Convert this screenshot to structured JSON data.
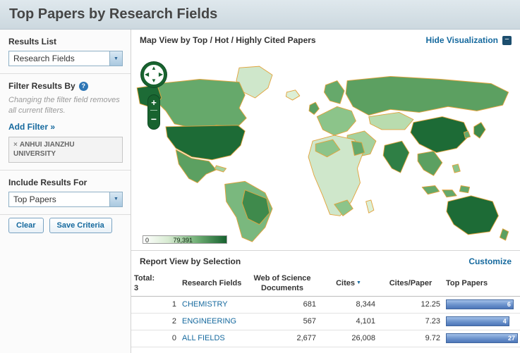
{
  "page": {
    "title": "Top Papers by Research Fields"
  },
  "icons": {
    "help": "?",
    "minus": "−",
    "select_arrow": "▼",
    "sort_desc": "▼",
    "pan_up": "▲",
    "pan_down": "▼",
    "pan_left": "◀",
    "pan_right": "▶",
    "zoom_in": "+",
    "zoom_out": "−"
  },
  "sidebar": {
    "results_list_label": "Results List",
    "results_list_value": "Research Fields",
    "filter_by_label": "Filter Results By",
    "filter_note": "Changing the filter field removes all current filters.",
    "add_filter_link": "Add Filter »",
    "filters": [
      {
        "remove": "×",
        "label": "ANHUI JIANZHU UNIVERSITY"
      }
    ],
    "include_label": "Include Results For",
    "include_value": "Top Papers",
    "clear_button": "Clear",
    "save_button": "Save Criteria"
  },
  "map": {
    "title": "Map View by Top / Hot / Highly Cited Papers",
    "hide_link": "Hide Visualization",
    "scale_min": "0",
    "scale_max": "79,391",
    "colors": {
      "lowest": "#f2f8ee",
      "highest": "#1d6b36",
      "country_border": "#e2a33c"
    }
  },
  "report": {
    "title": "Report View by Selection",
    "customize_link": "Customize",
    "total_label": "Total:",
    "total_value": "3",
    "columns": {
      "fields": "Research Fields",
      "docs_line1": "Web of Science",
      "docs_line2": "Documents",
      "cites": "Cites",
      "cites_per_paper": "Cites/Paper",
      "top_papers": "Top Papers"
    },
    "rows": [
      {
        "rank": "1",
        "field": "CHEMISTRY",
        "docs": "681",
        "cites": "8,344",
        "cites_per_paper": "12.25",
        "top_papers": "6",
        "bar_pct": "94%"
      },
      {
        "rank": "2",
        "field": "ENGINEERING",
        "docs": "567",
        "cites": "4,101",
        "cites_per_paper": "7.23",
        "top_papers": "4",
        "bar_pct": "88%"
      },
      {
        "rank": "0",
        "field": "ALL FIELDS",
        "docs": "2,677",
        "cites": "26,008",
        "cites_per_paper": "9.72",
        "top_papers": "27",
        "bar_pct": "100%"
      }
    ]
  }
}
